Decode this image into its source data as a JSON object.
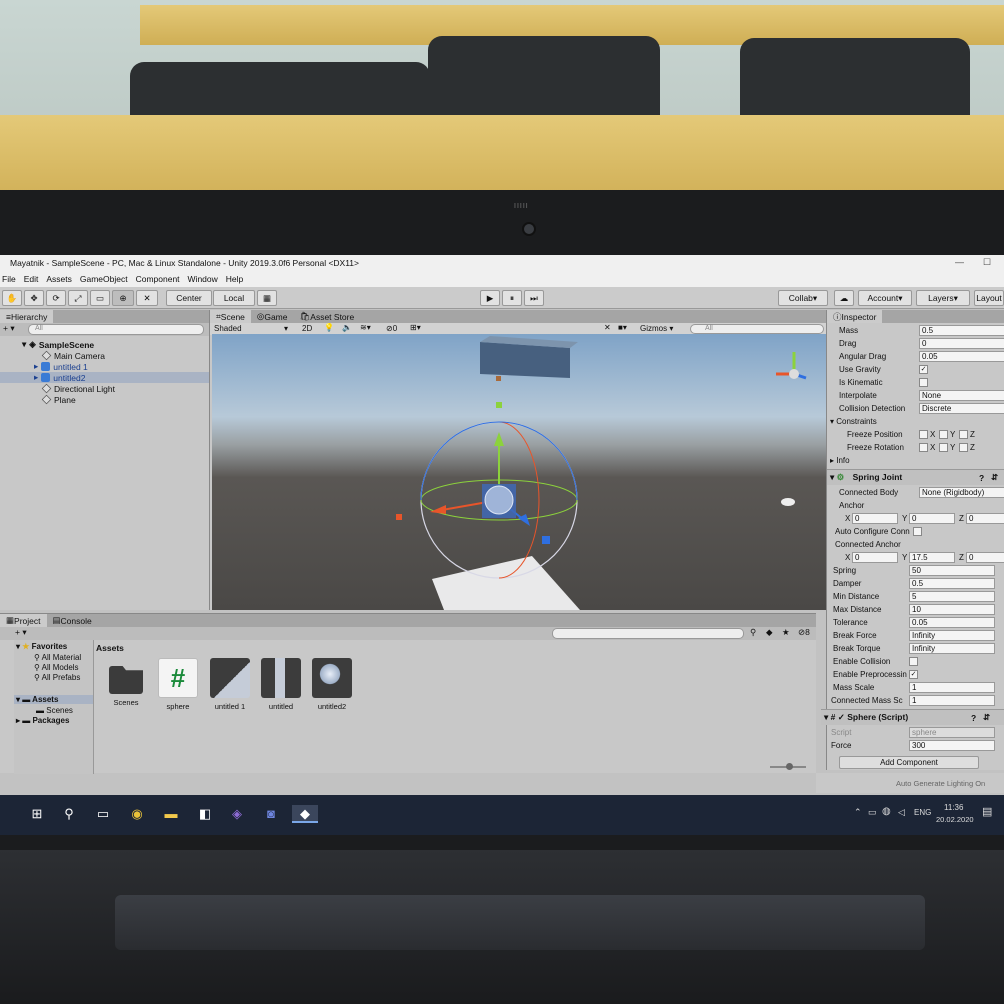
{
  "window": {
    "title": "Mayatnik - SampleScene - PC, Mac & Linux Standalone - Unity 2019.3.0f6 Personal <DX11>"
  },
  "menu": [
    "File",
    "Edit",
    "Assets",
    "GameObject",
    "Component",
    "Window",
    "Help"
  ],
  "toolbar": {
    "pivot_label": "Center",
    "space_label": "Local",
    "collab_label": "Collab",
    "account_label": "Account",
    "layers_label": "Layers",
    "layout_label": "Layout"
  },
  "hierarchy": {
    "tab_label": "Hierarchy",
    "search_placeholder": "All",
    "scene_name": "SampleScene",
    "items": [
      "Main Camera",
      "untitled 1",
      "untitled2",
      "Directional Light",
      "Plane"
    ]
  },
  "scene": {
    "tabs": [
      "Scene",
      "Game",
      "Asset Store"
    ],
    "shading_mode": "Shaded",
    "mode_2d": "2D",
    "hidden_count": "0",
    "gizmos_label": "Gizmos",
    "search_placeholder": "All"
  },
  "inspector": {
    "tab_label": "Inspector",
    "rigidbody_fields": [
      {
        "label": "Mass",
        "value": "0.5"
      },
      {
        "label": "Drag",
        "value": "0"
      },
      {
        "label": "Angular Drag",
        "value": "0.05"
      },
      {
        "label": "Interpolate",
        "value": "None"
      },
      {
        "label": "Collision Detection",
        "value": "Discrete"
      }
    ],
    "use_gravity_label": "Use Gravity",
    "use_gravity": true,
    "is_kinematic_label": "Is Kinematic",
    "is_kinematic": false,
    "constraints_label": "Constraints",
    "freeze_position_label": "Freeze Position",
    "freeze_rotation_label": "Freeze Rotation",
    "axis_x": "X",
    "axis_y": "Y",
    "axis_z": "Z",
    "info_label": "Info",
    "spring_joint": {
      "title": "Spring Joint",
      "connected_body_label": "Connected Body",
      "connected_body": "None (Rigidbody)",
      "anchor_label": "Anchor",
      "anchor_x": "0",
      "anchor_y": "0",
      "anchor_z": "0",
      "auto_configure_label": "Auto Configure Conn",
      "connected_anchor_label": "Connected Anchor",
      "connected_anchor_x": "0",
      "connected_anchor_y": "17.5",
      "connected_anchor_z": "0",
      "fields": [
        {
          "label": "Spring",
          "value": "50"
        },
        {
          "label": "Damper",
          "value": "0.5"
        },
        {
          "label": "Min Distance",
          "value": "5"
        },
        {
          "label": "Max Distance",
          "value": "10"
        },
        {
          "label": "Tolerance",
          "value": "0.05"
        },
        {
          "label": "Break Force",
          "value": "Infinity"
        },
        {
          "label": "Break Torque",
          "value": "Infinity"
        }
      ],
      "enable_collision_label": "Enable Collision",
      "enable_preprocessing_label": "Enable Preprocessin",
      "mass_scale_label": "Mass Scale",
      "mass_scale": "1",
      "connected_mass_scale_label": "Connected Mass Sc",
      "connected_mass_scale": "1"
    },
    "script_component": {
      "title": "Sphere (Script)",
      "script_label": "Script",
      "script_value": "sphere",
      "force_label": "Force",
      "force_value": "300"
    },
    "add_component_label": "Add Component"
  },
  "project": {
    "tabs": [
      "Project",
      "Console"
    ],
    "favorites_label": "Favorites",
    "favorites": [
      "All Material",
      "All Models",
      "All Prefabs"
    ],
    "assets_label": "Assets",
    "scenes_label": "Scenes",
    "packages_label": "Packages",
    "breadcrumb": "Assets",
    "hidden_count": "8",
    "assets": [
      "Scenes",
      "sphere",
      "untitled 1",
      "untitled",
      "untitled2"
    ]
  },
  "status": {
    "message": "Auto Generate Lighting On"
  },
  "taskbar": {
    "language": "ENG",
    "time": "11:36",
    "date": "20.02.2020"
  },
  "colors": {
    "unity_bg": "#c8c8c8",
    "axis_x": "#e8552a",
    "axis_y": "#8cd23c",
    "axis_z": "#2f6fe0",
    "taskbar": "#1c2536"
  }
}
